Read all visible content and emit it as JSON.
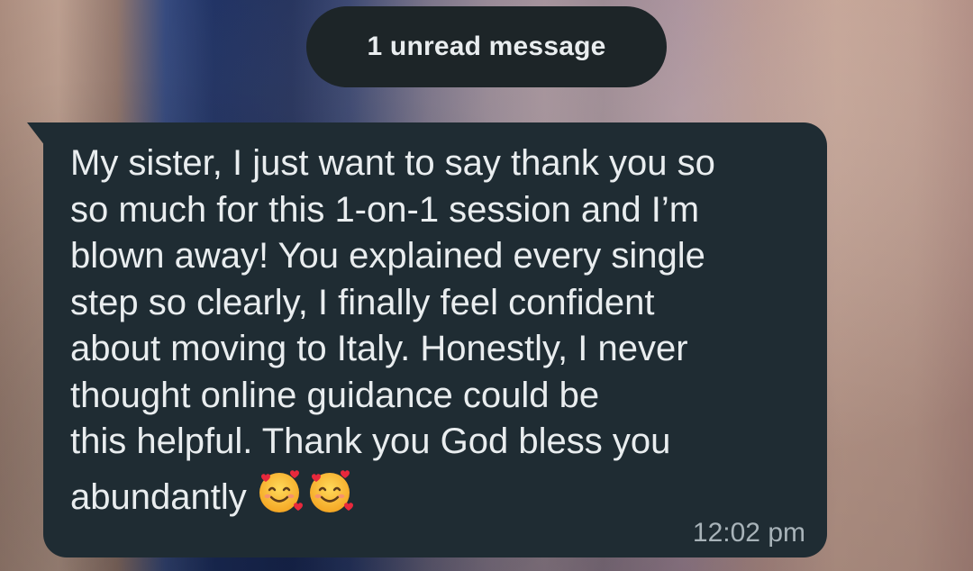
{
  "banner": {
    "unread_label": "1 unread message"
  },
  "message": {
    "text_lines": [
      "My sister, I just want to say thank you so",
      "so much for this 1-on-1 session and I’m",
      "blown away! You explained every single",
      "step so clearly, I finally feel confident",
      "about moving to Italy. Honestly, I never",
      "thought online guidance could be",
      "this helpful. Thank you God bless you",
      "abundantly"
    ],
    "emoji": [
      "smiling-face-with-hearts-icon",
      "smiling-face-with-hearts-icon"
    ],
    "time": "12:02 pm"
  },
  "colors": {
    "bubble": "#1f2c33",
    "pill": "#1d2528",
    "text": "#e9edef",
    "timestamp": "#a8b3b9"
  }
}
